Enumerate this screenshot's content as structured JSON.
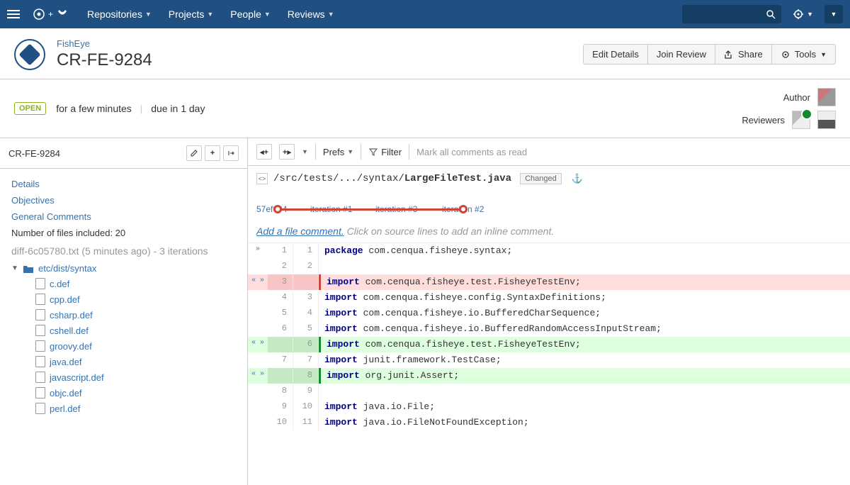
{
  "nav": {
    "items": [
      "Repositories",
      "Projects",
      "People",
      "Reviews"
    ]
  },
  "header": {
    "breadcrumb": "FishEye",
    "title": "CR-FE-9284",
    "actions": {
      "edit": "Edit Details",
      "join": "Join Review",
      "share": "Share",
      "tools": "Tools"
    }
  },
  "subheader": {
    "status": "OPEN",
    "age": "for a few minutes",
    "due": "due in 1 day",
    "author_label": "Author",
    "reviewers_label": "Reviewers"
  },
  "sidebar": {
    "key": "CR-FE-9284",
    "links": {
      "details": "Details",
      "objectives": "Objectives",
      "general": "General Comments"
    },
    "file_count_label": "Number of files included: 20",
    "diff_meta": "diff-6c05780.txt (5 minutes ago) - 3 iterations",
    "folder": "etc/dist/syntax",
    "files": [
      "c.def",
      "cpp.def",
      "csharp.def",
      "cshell.def",
      "groovy.def",
      "java.def",
      "javascript.def",
      "objc.def",
      "perl.def"
    ]
  },
  "toolbar": {
    "prefs": "Prefs",
    "filter": "Filter",
    "mark_read": "Mark all comments as read"
  },
  "file": {
    "path_prefix": "/src/tests/.../syntax/",
    "filename": "LargeFileTest.java",
    "changed_tag": "Changed"
  },
  "iterations": {
    "commit": "57ef004",
    "labels": [
      "iteration #1",
      "iteration #3",
      "iteration #2"
    ]
  },
  "comment_hint": {
    "add": "Add a file comment.",
    "rest": "Click on source lines to add an inline comment."
  },
  "diff": [
    {
      "type": "ctx",
      "ln_old": "1",
      "ln_new": "1",
      "expand": "»",
      "code": "package com.cenqua.fisheye.syntax;",
      "kw": "package"
    },
    {
      "type": "ctx",
      "ln_old": "2",
      "ln_new": "2",
      "expand": "",
      "code": "",
      "kw": ""
    },
    {
      "type": "removed",
      "ln_old": "3",
      "ln_new": "",
      "expand": "« »",
      "code": "import com.cenqua.fisheye.test.FisheyeTestEnv;",
      "kw": "import"
    },
    {
      "type": "ctx",
      "ln_old": "4",
      "ln_new": "3",
      "expand": "",
      "code": "import com.cenqua.fisheye.config.SyntaxDefinitions;",
      "kw": "import"
    },
    {
      "type": "ctx",
      "ln_old": "5",
      "ln_new": "4",
      "expand": "",
      "code": "import com.cenqua.fisheye.io.BufferedCharSequence;",
      "kw": "import"
    },
    {
      "type": "ctx",
      "ln_old": "6",
      "ln_new": "5",
      "expand": "",
      "code": "import com.cenqua.fisheye.io.BufferedRandomAccessInputStream;",
      "kw": "import"
    },
    {
      "type": "added",
      "ln_old": "",
      "ln_new": "6",
      "expand": "« »",
      "code": "import com.cenqua.fisheye.test.FisheyeTestEnv;",
      "kw": "import"
    },
    {
      "type": "ctx",
      "ln_old": "7",
      "ln_new": "7",
      "expand": "",
      "code": "import junit.framework.TestCase;",
      "kw": "import"
    },
    {
      "type": "added",
      "ln_old": "",
      "ln_new": "8",
      "expand": "« »",
      "code": "import org.junit.Assert;",
      "kw": "import"
    },
    {
      "type": "ctx",
      "ln_old": "8",
      "ln_new": "9",
      "expand": "",
      "code": "",
      "kw": ""
    },
    {
      "type": "ctx",
      "ln_old": "9",
      "ln_new": "10",
      "expand": "",
      "code": "import java.io.File;",
      "kw": "import"
    },
    {
      "type": "ctx",
      "ln_old": "10",
      "ln_new": "11",
      "expand": "",
      "code": "import java.io.FileNotFoundException;",
      "kw": "import"
    }
  ]
}
